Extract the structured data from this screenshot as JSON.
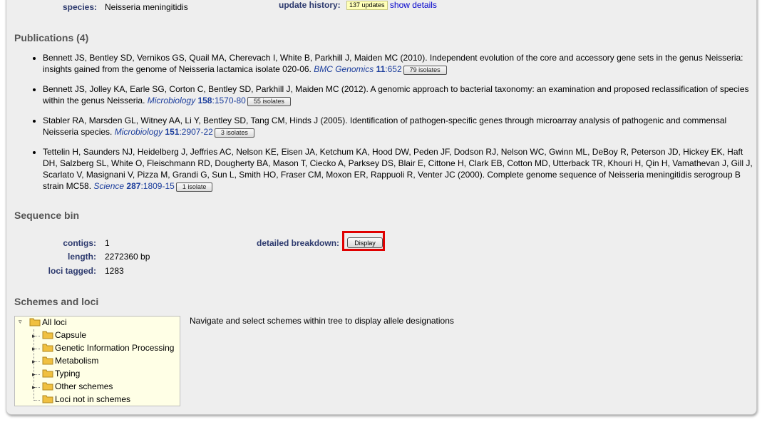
{
  "top": {
    "species_label": "species:",
    "species_value": "Neisseria meningitidis",
    "update_label": "update history:",
    "update_badge": "137 updates",
    "update_link": "show details"
  },
  "publications": {
    "heading": "Publications (4)",
    "items": [
      {
        "text": "Bennett JS, Bentley SD, Vernikos GS, Quail MA, Cherevach I, White B, Parkhill J, Maiden MC (2010). Independent evolution of the core and accessory gene sets in the genus Neisseria: insights gained from the genome of Neisseria lactamica isolate 020-06. ",
        "journal": "BMC Genomics",
        "volume": "11",
        "pages": ":652",
        "isolates": "79 isolates"
      },
      {
        "text": "Bennett JS, Jolley KA, Earle SG, Corton C, Bentley SD, Parkhill J, Maiden MC (2012). A genomic approach to bacterial taxonomy: an examination and proposed reclassification of species within the genus Neisseria. ",
        "journal": "Microbiology",
        "volume": "158",
        "pages": ":1570-80",
        "isolates": "55 isolates"
      },
      {
        "text": "Stabler RA, Marsden GL, Witney AA, Li Y, Bentley SD, Tang CM, Hinds J (2005). Identification of pathogen-specific genes through microarray analysis of pathogenic and commensal Neisseria species. ",
        "journal": "Microbiology",
        "volume": "151",
        "pages": ":2907-22",
        "isolates": "3 isolates"
      },
      {
        "text": "Tettelin H, Saunders NJ, Heidelberg J, Jeffries AC, Nelson KE, Eisen JA, Ketchum KA, Hood DW, Peden JF, Dodson RJ, Nelson WC, Gwinn ML, DeBoy R, Peterson JD, Hickey EK, Haft DH, Salzberg SL, White O, Fleischmann RD, Dougherty BA, Mason T, Ciecko A, Parksey DS, Blair E, Cittone H, Clark EB, Cotton MD, Utterback TR, Khouri H, Qin H, Vamathevan J, Gill J, Scarlato V, Masignani V, Pizza M, Grandi G, Sun L, Smith HO, Fraser CM, Moxon ER, Rappuoli R, Venter JC (2000). Complete genome sequence of Neisseria meningitidis serogroup B strain MC58. ",
        "journal": "Science",
        "volume": "287",
        "pages": ":1809-15",
        "isolates": "1 isolate"
      }
    ]
  },
  "sequence_bin": {
    "heading": "Sequence bin",
    "contigs_label": "contigs:",
    "contigs_value": "1",
    "length_label": "length:",
    "length_value": "2272360 bp",
    "loci_label": "loci tagged:",
    "loci_value": "1283",
    "breakdown_label": "detailed breakdown:",
    "display_button": "Display"
  },
  "schemes": {
    "heading": "Schemes and loci",
    "instruction": "Navigate and select schemes within tree to display allele designations",
    "tree_root": "All loci",
    "tree_children": [
      "Capsule",
      "Genetic Information Processing",
      "Metabolism",
      "Typing",
      "Other schemes",
      "Loci not in schemes"
    ]
  },
  "colors": {
    "label": "#2d3a6e",
    "link": "#0000cc",
    "highlight_box": "#e00000",
    "tree_bg": "#ffffe6"
  }
}
